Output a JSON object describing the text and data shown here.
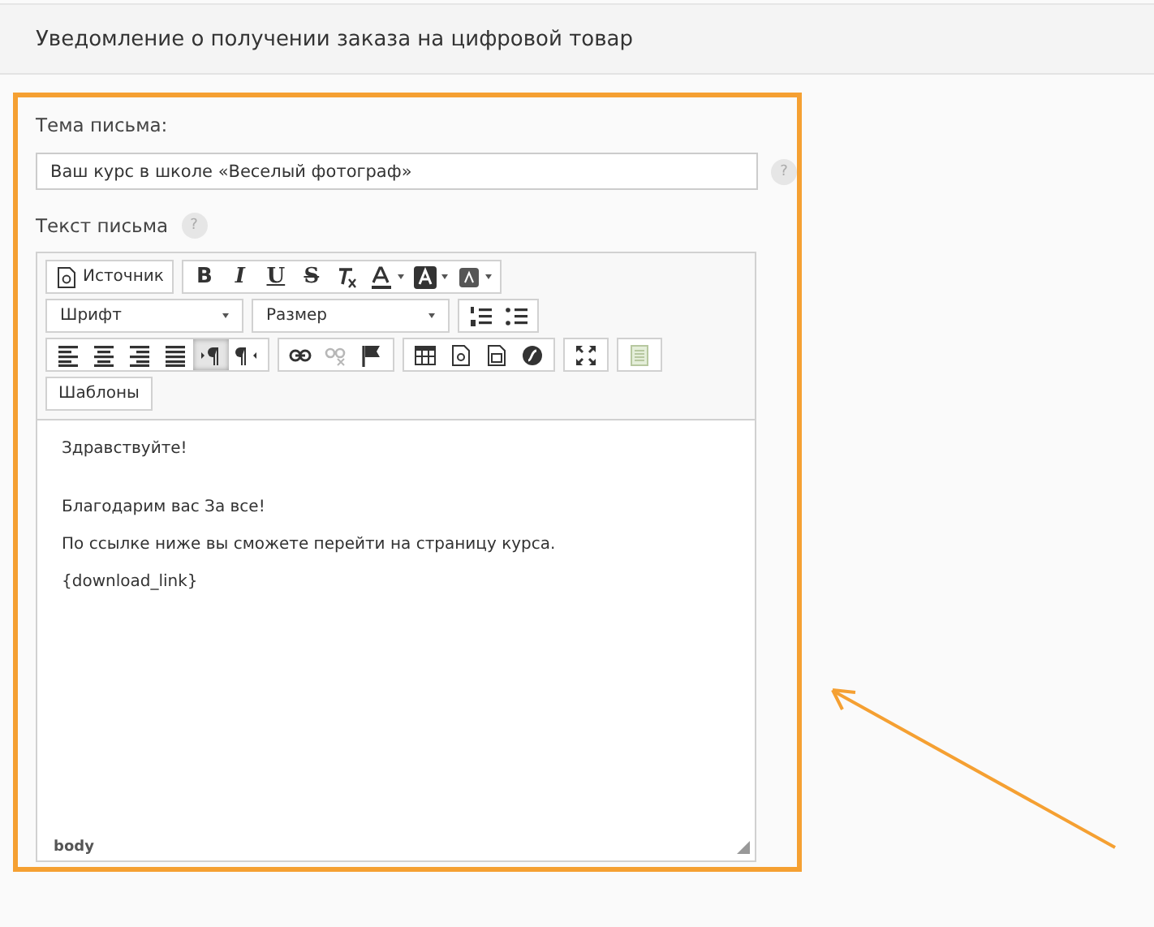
{
  "header": {
    "title": "Уведомление о получении заказа на цифровой товар"
  },
  "subject": {
    "label": "Тема письма:",
    "value": "Ваш курс в школе «Веселый фотограф»",
    "help": "?"
  },
  "body_field": {
    "label": "Текст письма",
    "help": "?"
  },
  "toolbar": {
    "rows": [
      [
        {
          "items": [
            {
              "kind": "source",
              "label": "Источник"
            }
          ]
        },
        {
          "items": [
            {
              "kind": "bold",
              "label": "B"
            },
            {
              "kind": "italic",
              "label": "I"
            },
            {
              "kind": "underline",
              "label": "U"
            },
            {
              "kind": "strike",
              "label": "S"
            },
            {
              "kind": "removeformat"
            },
            {
              "kind": "textcolor"
            },
            {
              "kind": "bgcolor"
            },
            {
              "kind": "style"
            }
          ]
        }
      ],
      [
        {
          "combo": "Шрифт"
        },
        {
          "combo": "Размер"
        },
        {
          "items": [
            {
              "kind": "numlist"
            },
            {
              "kind": "bullist"
            }
          ]
        }
      ],
      [
        {
          "items": [
            {
              "kind": "alignleft",
              "selected": false
            },
            {
              "kind": "aligncenter",
              "selected": false
            },
            {
              "kind": "alignright",
              "selected": false
            },
            {
              "kind": "justify",
              "selected": false
            },
            {
              "kind": "ltr",
              "selected": true
            },
            {
              "kind": "rtl",
              "selected": false
            }
          ]
        },
        {
          "items": [
            {
              "kind": "link",
              "disabled": false
            },
            {
              "kind": "unlink",
              "disabled": true
            },
            {
              "kind": "anchor",
              "disabled": false
            }
          ]
        },
        {
          "items": [
            {
              "kind": "table"
            },
            {
              "kind": "template"
            },
            {
              "kind": "iframe"
            },
            {
              "kind": "flash"
            }
          ]
        },
        {
          "items": [
            {
              "kind": "maximize"
            }
          ]
        },
        {
          "items": [
            {
              "kind": "paste"
            }
          ]
        }
      ],
      [
        {
          "items": [
            {
              "kind": "templates",
              "label": "Шаблоны"
            }
          ]
        }
      ]
    ]
  },
  "content": [
    "Здравствуйте!",
    "Благодарим вас За все!",
    "По ссылке ниже вы сможете перейти на страницу курса.",
    "{download_link}"
  ],
  "status": "body"
}
